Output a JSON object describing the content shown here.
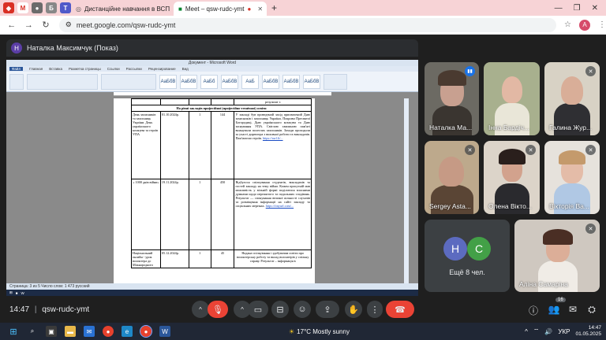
{
  "browser": {
    "tabs": [
      {
        "label": "",
        "icon": "red-app-icon"
      },
      {
        "label": "",
        "icon": "gmail-icon"
      },
      {
        "label": "",
        "icon": "dot-icon"
      },
      {
        "label": "",
        "icon": "bookmark-icon"
      },
      {
        "label": "",
        "icon": "teams-icon"
      },
      {
        "label": "Дистанційне навчання в ВСП",
        "icon": "globe-icon"
      },
      {
        "label": "Meet – qsw-rudc-ymt",
        "icon": "meet-icon",
        "active": true
      }
    ],
    "url": "meet.google.com/qsw-rudc-ymt",
    "profile_initial": "A"
  },
  "presenter": {
    "initial": "Н",
    "name": "Наталка Максимчук (Показ)"
  },
  "word": {
    "title": "Документ - Microsoft Word",
    "ribbon_tabs": [
      "Файл",
      "Главная",
      "Вставка",
      "Разметка страницы",
      "Ссылки",
      "Рассылки",
      "Рецензирование",
      "Вид"
    ],
    "styles": [
      "АаБбВ",
      "АаБбВ",
      "АаБб",
      "АаБбВ",
      "АаБ",
      "АаБбВ",
      "АаБбВ",
      "АаБбВ"
    ],
    "doc": {
      "top_cell": "результат з",
      "section": "На рівні закладів професійної (професійно-технічної) освіти",
      "rows": [
        {
          "c1": "День захисників та захисниць України. День українського козацтва та героїв УПА",
          "c2": "01.10.2024р.",
          "c3": "1",
          "c4": "144",
          "c5": "У закладі був проведений захід присвячений Дню захисників і захисниць України, Покрови Пресвятої Богородиці, Дню українського козацтва та Дню заснування УПА. Світлою хвилиною пам'яті вшанували полеглих захисників. Заходи проходили за участі директора з виховної роботи та викладачів. Пам'ятаємо героїв.",
          "link": "https://surl.li/..."
        },
        {
          "c1": "« 1000 днів війни»",
          "c2": "19.11.2024р.",
          "c3": "1",
          "c4": "450",
          "c5": "Відбулося спілкування студентів, викладачів та гостей закладу на тему війни. Кожен присутній мав можливість у вільній формі поділитися власними думками щодо пережитого та подальших сподівань. Результат — спонукання великої кількості слухачів та розміщення інформації на сайті закладу та соціальних мережах.",
          "link": "https://tinyurl.com/..."
        },
        {
          "c1": "Національний онлайн - урок волонтера до Міжнародного",
          "c2": "05.12.2024р.",
          "c3": "1",
          "c4": "45",
          "c5": "Надана спілкування і здобувачам освіти про волонтерську роботу та вклад волонтерів у спільну справу. Результат – інформація в",
          "link": ""
        }
      ]
    },
    "status": "Страница: 3 из 5   Число слов: 1 473   русский"
  },
  "participants": [
    {
      "name": "Наталка Ма...",
      "speaking": true
    },
    {
      "name": "Інна Бардіч..."
    },
    {
      "name": "Галина Жур..."
    },
    {
      "name": "Sergey Asta..."
    },
    {
      "name": "Олена Вікто..."
    },
    {
      "name": "Вікторія Ва..."
    },
    {
      "name": "Аліна Самаріна"
    }
  ],
  "others": {
    "avatars": [
      "H",
      "C"
    ],
    "label": "Ещё 8 чел."
  },
  "meeting": {
    "time": "14:47",
    "code": "qsw-rudc-ymt",
    "participants_count": "16"
  },
  "taskbar": {
    "weather": "17°C  Mostly sunny",
    "lang": "УКР",
    "time": "14:47",
    "date": "01.05.2025"
  }
}
